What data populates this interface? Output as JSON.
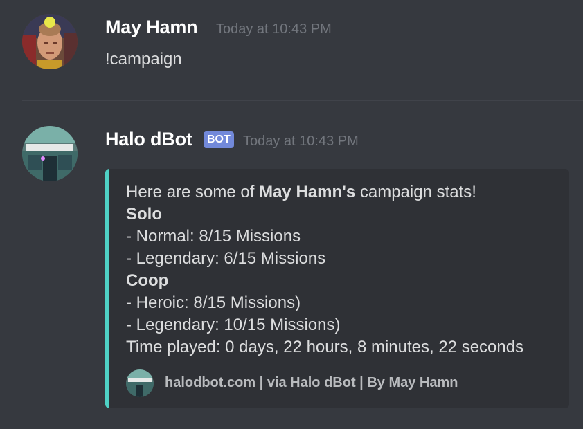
{
  "messages": [
    {
      "author": "May Hamn",
      "timestamp": "Today at 10:43 PM",
      "text": "!campaign",
      "avatar_icon": "user-avatar-icon"
    },
    {
      "author": "Halo dBot",
      "badge": "BOT",
      "timestamp": "Today at 10:43 PM",
      "avatar_icon": "halo-helmet-icon",
      "embed": {
        "accent_color": "#4fd1c5",
        "intro_prefix": "Here are some of ",
        "intro_name": "May Hamn's",
        "intro_suffix": " campaign stats!",
        "solo_heading": "Solo",
        "solo_normal": "- Normal: 8/15 Missions",
        "solo_legendary": "- Legendary: 6/15 Missions",
        "coop_heading": "Coop",
        "coop_heroic": "- Heroic: 8/15 Missions)",
        "coop_legendary": "- Legendary: 10/15 Missions)",
        "time_played": "Time played: 0 days, 22 hours, 8 minutes, 22 seconds",
        "footer": "halodbot.com | via Halo dBot | By May Hamn"
      }
    }
  ],
  "colors": {
    "background": "#36393f",
    "embed_background": "#2f3136",
    "bot_badge": "#7289da",
    "timestamp": "#72767d"
  }
}
